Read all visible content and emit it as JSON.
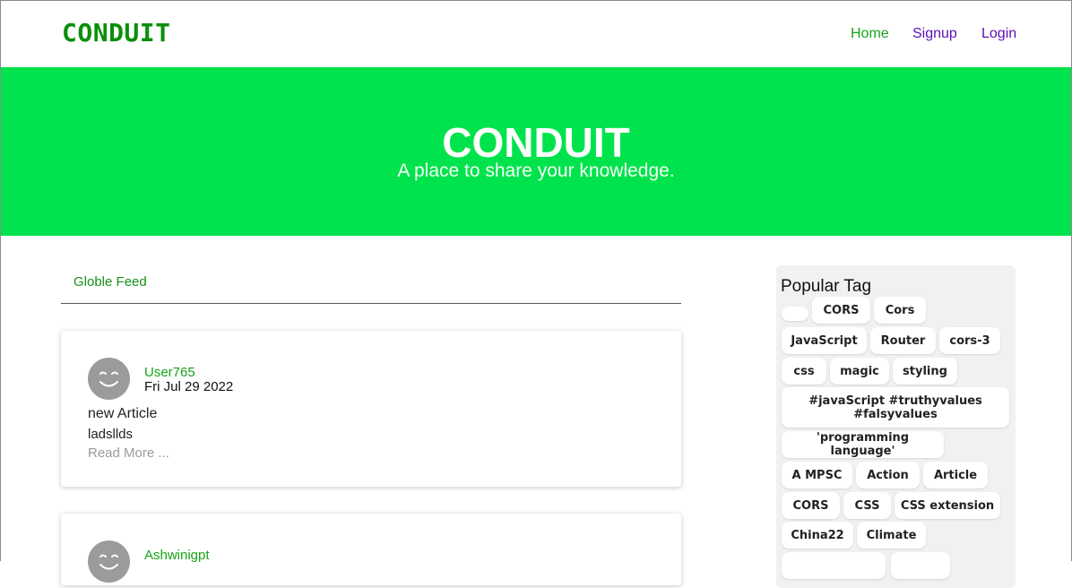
{
  "header": {
    "brand": "CONDUIT",
    "nav": {
      "home": "Home",
      "signup": "Signup",
      "login": "Login"
    }
  },
  "hero": {
    "title": "CONDUIT",
    "subtitle": "A place to share your knowledge."
  },
  "feed": {
    "tab_label": "Globle Feed",
    "articles": [
      {
        "author": "User765",
        "date": "Fri Jul 29 2022",
        "title": "new Article",
        "description": "ladsllds",
        "read_more": "Read More ..."
      },
      {
        "author": "Ashwinigpt"
      }
    ]
  },
  "sidebar": {
    "title": "Popular Tag",
    "tags": [
      "",
      "CORS",
      "Cors",
      "JavaScript",
      "Router",
      "cors-3",
      "css",
      "magic",
      "styling",
      "#javaScript #truthyvalues #falsyvalues",
      "'programming language'",
      "A MPSC",
      "Action",
      "Article",
      "CORS",
      "CSS",
      "CSS extension",
      "China22",
      "Climate"
    ]
  },
  "colors": {
    "brand_green": "#0a8f0a",
    "hero_green": "#00e34c",
    "link_purple": "#5b0fb5",
    "sidebar_bg": "#f1f1f3"
  }
}
